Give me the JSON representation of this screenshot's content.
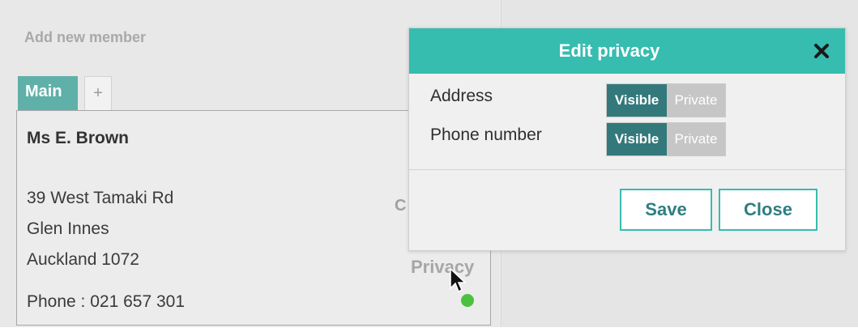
{
  "panel": {
    "title": "Add new member"
  },
  "tabs": {
    "main_label": "Main",
    "add_label": "+"
  },
  "member": {
    "name": "Ms E. Brown",
    "address_lines": [
      "39 West Tamaki Rd",
      "Glen Innes",
      "Auckland 1072"
    ],
    "phone": "Phone : 021 657 301",
    "partial_label": "C",
    "privacy_link": "Privacy",
    "status_color": "#4cc13e"
  },
  "modal": {
    "title": "Edit privacy",
    "close_icon": "close-x-icon",
    "fields": [
      {
        "label": "Address",
        "visible_label": "Visible",
        "private_label": "Private",
        "selected": "Visible"
      },
      {
        "label": "Phone number",
        "visible_label": "Visible",
        "private_label": "Private",
        "selected": "Visible"
      }
    ],
    "save_label": "Save",
    "close_label": "Close"
  },
  "colors": {
    "accent": "#37bcb0",
    "toggle_selected": "#33797c",
    "toggle_unselected": "#c6c6c6",
    "tab_active": "#5fb0a8"
  }
}
